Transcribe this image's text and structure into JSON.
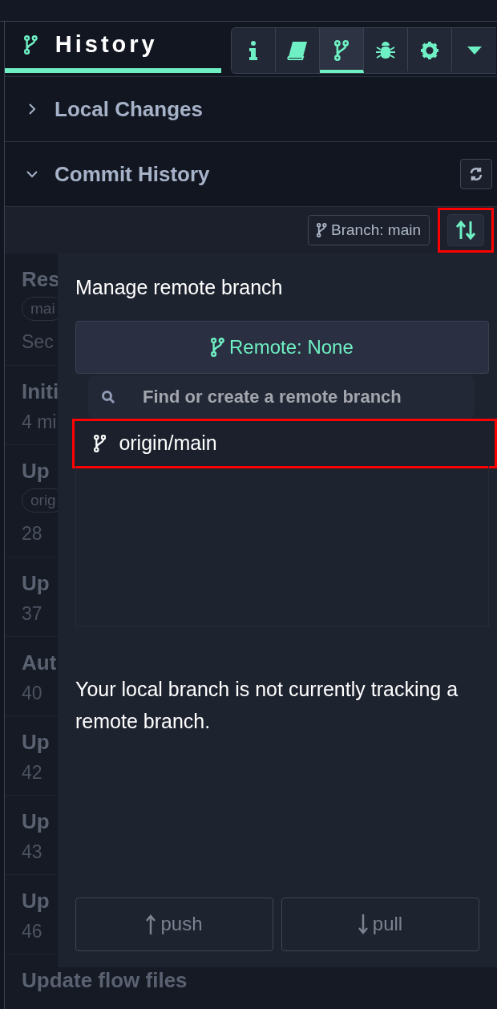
{
  "panel_tab": {
    "label": "History",
    "selected": true
  },
  "toolbar": [
    {
      "kind": "info",
      "selected": false
    },
    {
      "kind": "book",
      "selected": false
    },
    {
      "kind": "branch",
      "selected": true
    },
    {
      "kind": "bug",
      "selected": false
    },
    {
      "kind": "gear",
      "selected": false
    },
    {
      "kind": "caret",
      "selected": false
    }
  ],
  "sections": [
    {
      "label": "Local Changes",
      "expanded": false
    },
    {
      "label": "Commit History",
      "expanded": true
    }
  ],
  "branch_button": {
    "label": "Branch: main"
  },
  "sync_button": {
    "highlighted": true
  },
  "commits": [
    {
      "title": "Res",
      "tag": "mai",
      "time": "Sec"
    },
    {
      "title": "Initi",
      "time": "4 mi"
    },
    {
      "title": "Up",
      "tag": "orig",
      "time": "28"
    },
    {
      "title": "Up",
      "time": "37"
    },
    {
      "title": "Aut",
      "time": "40"
    },
    {
      "title": "Up",
      "time": "42"
    },
    {
      "title": "Up",
      "time": "43"
    },
    {
      "title": "Up",
      "time": "46"
    },
    {
      "title": "Update flow files"
    }
  ],
  "popover": {
    "title": "Manage remote branch",
    "remote_button": "Remote: None",
    "search": {
      "placeholder": "Find or create a remote branch"
    },
    "options": [
      {
        "label": "origin/main",
        "highlighted": true
      }
    ],
    "message": "Your local branch is not currently tracking a remote branch.",
    "actions": [
      {
        "kind": "push",
        "label": "push",
        "disabled": true
      },
      {
        "kind": "pull",
        "label": "pull",
        "disabled": true
      }
    ]
  }
}
